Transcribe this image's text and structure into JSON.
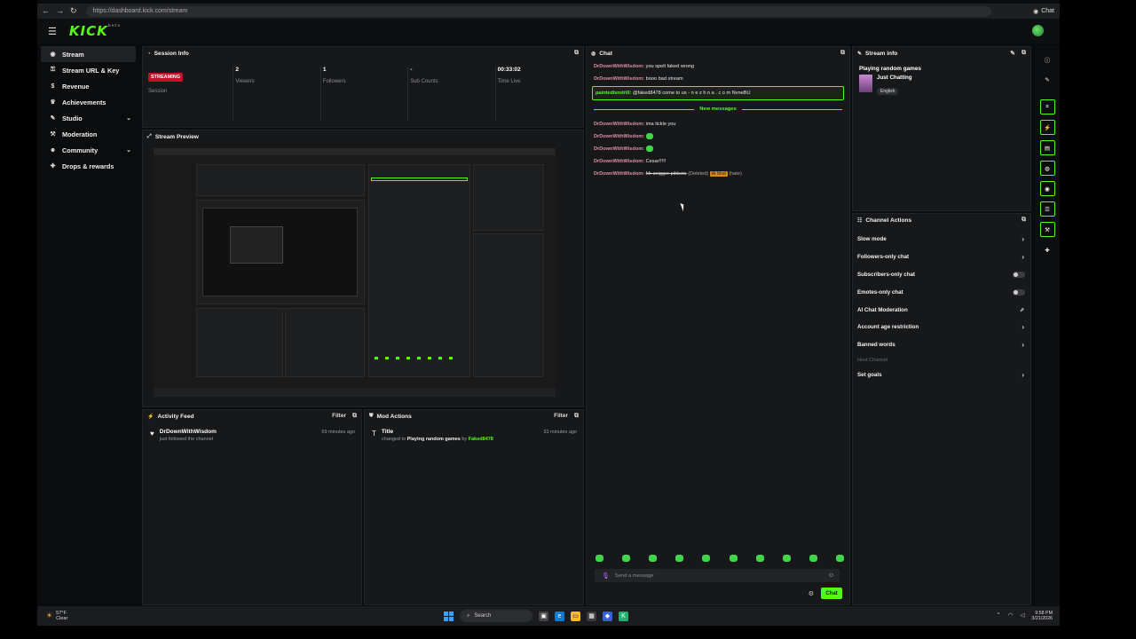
{
  "browser": {
    "url": "https://dashboard.kick.com/stream",
    "chat_label": "Chat"
  },
  "header": {
    "logo": "KICK",
    "logo_tag": "beta"
  },
  "sidebar": {
    "items": [
      {
        "label": "Stream",
        "icon": "broadcast-icon"
      },
      {
        "label": "Stream URL & Key",
        "icon": "key-icon"
      },
      {
        "label": "Revenue",
        "icon": "dollar-icon"
      },
      {
        "label": "Achievements",
        "icon": "trophy-icon"
      },
      {
        "label": "Studio",
        "icon": "brush-icon"
      },
      {
        "label": "Moderation",
        "icon": "wrench-icon"
      },
      {
        "label": "Community",
        "icon": "users-icon"
      },
      {
        "label": "Drops & rewards",
        "icon": "gift-icon"
      }
    ]
  },
  "session": {
    "title": "Session Info",
    "status_badge": "STREAMING",
    "status_label": "Session",
    "viewers_value": "2",
    "viewers_label": "Viewers",
    "followers_value": "1",
    "followers_label": "Followers",
    "subs_value": "-",
    "subs_label": "Sub Counts",
    "time_value": "00:33:02",
    "time_label": "Time Live"
  },
  "preview": {
    "title": "Stream Preview"
  },
  "activity": {
    "title": "Activity Feed",
    "filter_label": "Filter",
    "item_name": "DrDownWithWisdom",
    "item_sub": "just followed the channel",
    "item_time": "59 minutes ago"
  },
  "mod_actions": {
    "title": "Mod Actions",
    "filter_label": "Filter",
    "item_title": "Title",
    "item_prefix": "changed to",
    "item_value": "Playing random games",
    "item_by": "by",
    "item_user": "Faked8478",
    "item_time": "33 minutes ago"
  },
  "chat": {
    "title": "Chat",
    "messages_top": [
      {
        "user": "DrDownWithWisdom:",
        "text": "you spelt faked wrong"
      },
      {
        "user": "DrDownWithWisdom:",
        "text": "booo bad stream"
      }
    ],
    "highlight": {
      "user": "paintedtendrill:",
      "text": "@faked8478 come to us - n e z h n a . c o m NvneBU"
    },
    "new_messages_label": "New messages",
    "messages_bottom": [
      {
        "user": "DrDownWithWisdom:",
        "text": "ima tickle you"
      },
      {
        "user": "DrDownWithWisdom:",
        "text": ""
      },
      {
        "user": "DrDownWithWisdom:",
        "text": ""
      },
      {
        "user": "DrDownWithWisdom:",
        "text": "Cesar!!!!!"
      }
    ],
    "deleted_msg": {
      "user": "DrDownWithWisdom:",
      "text": "Mr snigger pibbets",
      "deleted_tag": "(Deleted)",
      "ai_tag": "AI Mod",
      "reason": "(hate)"
    },
    "input_placeholder": "Send a message",
    "send_label": "Chat"
  },
  "stream_info": {
    "title": "Stream info",
    "stream_title": "Playing random games",
    "category": "Just Chatting",
    "language": "English"
  },
  "channel_actions": {
    "title": "Channel Actions",
    "rows": [
      {
        "label": "Slow mode",
        "control": "chevron"
      },
      {
        "label": "Followers-only chat",
        "control": "chevron"
      },
      {
        "label": "Subscribers-only chat",
        "control": "toggle"
      },
      {
        "label": "Emotes-only chat",
        "control": "toggle"
      },
      {
        "label": "AI Chat Moderation",
        "control": "external"
      },
      {
        "label": "Account age restriction",
        "control": "chevron"
      },
      {
        "label": "Banned words",
        "control": "chevron"
      },
      {
        "label": "Host Channel",
        "control": "none"
      },
      {
        "label": "Set goals",
        "control": "chevron"
      }
    ]
  },
  "taskbar": {
    "temp": "57°F",
    "weather": "Clear",
    "search_label": "Search",
    "time": "9:58 PM",
    "date": "3/21/2026"
  },
  "colors": {
    "accent": "#53fc18",
    "streaming": "#c6112b",
    "panel": "#17181a"
  }
}
